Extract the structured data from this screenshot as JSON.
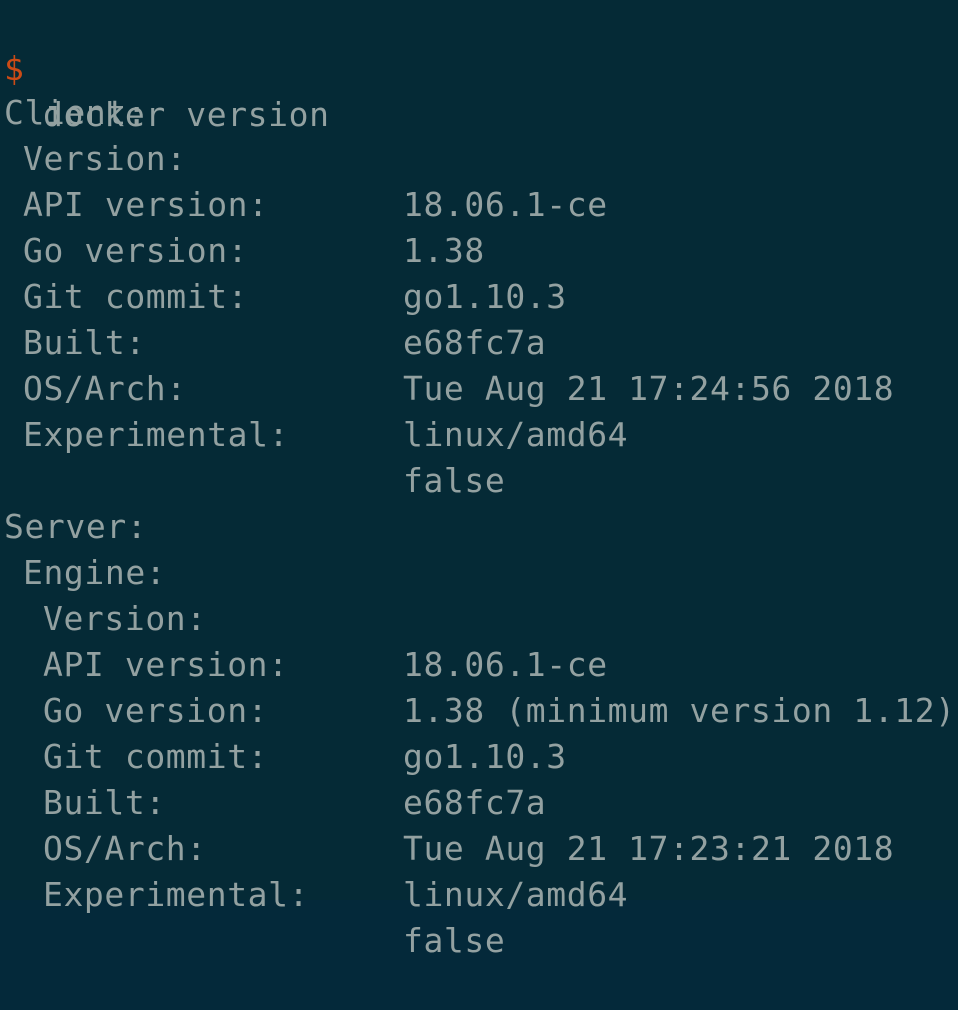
{
  "colors": {
    "background": "#052a36",
    "text": "#93a1a1",
    "prompt": "#cb4b16"
  },
  "command": {
    "prompt_symbol": "$",
    "text": "docker version"
  },
  "client": {
    "header": "Client:",
    "rows": [
      {
        "key": "Version:",
        "value": "18.06.1-ce"
      },
      {
        "key": "API version:",
        "value": "1.38"
      },
      {
        "key": "Go version:",
        "value": "go1.10.3"
      },
      {
        "key": "Git commit:",
        "value": "e68fc7a"
      },
      {
        "key": "Built:",
        "value": "Tue Aug 21 17:24:56 2018"
      },
      {
        "key": "OS/Arch:",
        "value": "linux/amd64"
      },
      {
        "key": "Experimental:",
        "value": "false"
      }
    ]
  },
  "server": {
    "header": "Server:",
    "engine_header": "Engine:",
    "rows": [
      {
        "key": "Version:",
        "value": "18.06.1-ce"
      },
      {
        "key": "API version:",
        "value": "1.38 (minimum version 1.12)"
      },
      {
        "key": "Go version:",
        "value": "go1.10.3"
      },
      {
        "key": "Git commit:",
        "value": "e68fc7a"
      },
      {
        "key": "Built:",
        "value": "Tue Aug 21 17:23:21 2018"
      },
      {
        "key": "OS/Arch:",
        "value": "linux/amd64"
      },
      {
        "key": "Experimental:",
        "value": "false"
      }
    ]
  }
}
